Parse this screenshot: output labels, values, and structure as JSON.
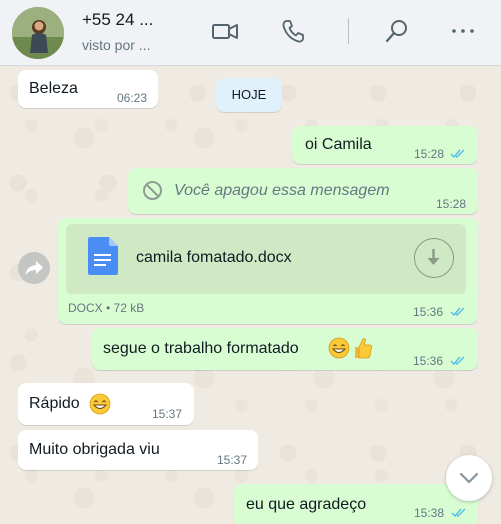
{
  "header": {
    "contact_name": "+55 24 ...",
    "contact_status": "visto por ...",
    "icons": [
      "video-call-icon",
      "voice-call-icon",
      "search-icon",
      "menu-icon"
    ]
  },
  "chat": {
    "date_chip": "HOJE",
    "messages": [
      {
        "direction": "in",
        "text": "Beleza",
        "time": "06:23"
      },
      {
        "direction": "out",
        "text": "oi Camila",
        "time": "15:28",
        "status": "read"
      },
      {
        "direction": "out",
        "text": "Você apagou essa mensagem",
        "time": "15:28",
        "deleted": true
      },
      {
        "direction": "out",
        "type": "document",
        "file_name": "camila fomatado.docx",
        "meta": "DOCX • 72 kB",
        "time": "15:36",
        "status": "read"
      },
      {
        "direction": "out",
        "text": "segue o trabalho formatado",
        "time": "15:36",
        "status": "read"
      },
      {
        "direction": "in",
        "text": "Rápido",
        "time": "15:37"
      },
      {
        "direction": "in",
        "text": "Muito obrigada viu",
        "time": "15:37"
      },
      {
        "direction": "out",
        "text": "eu que agradeço",
        "time": "15:38",
        "status": "read"
      }
    ]
  },
  "colors": {
    "incoming_bubble": "#ffffff",
    "outgoing_bubble": "#d9fdd3",
    "read_ticks": "#53bdeb",
    "chat_background": "#efeae2"
  }
}
